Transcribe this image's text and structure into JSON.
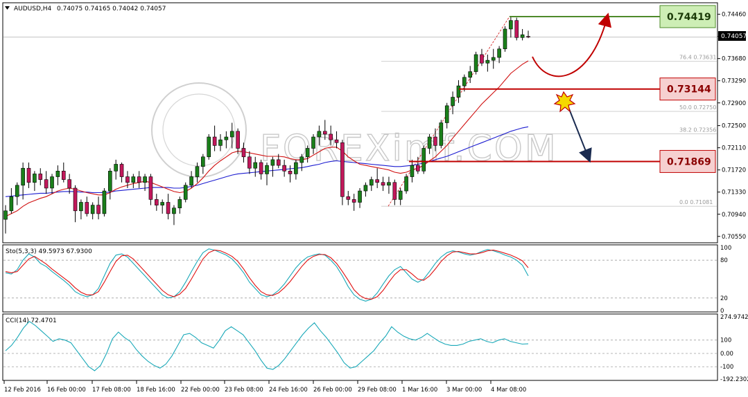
{
  "chart_data": [
    {
      "type": "candlestick",
      "header": {
        "symbol_tf": "AUDUSD,H4",
        "ohlc": "0.74075 0.74165 0.74042 0.74057"
      },
      "y_ticks": [
        "0.74460",
        "0.74070",
        "0.73680",
        "0.73290",
        "0.72900",
        "0.72500",
        "0.72110",
        "0.71720",
        "0.71330",
        "0.70940",
        "0.70550"
      ],
      "y_tick_values": [
        0.7446,
        0.7407,
        0.7368,
        0.7329,
        0.729,
        0.725,
        0.7211,
        0.7172,
        0.7133,
        0.7094,
        0.7055
      ],
      "current_price": "0.74057",
      "ylim": [
        0.7045,
        0.7465
      ],
      "x_ticks": [
        "12 Feb 2016",
        "16 Feb 00:00",
        "17 Feb 08:00",
        "18 Feb 16:00",
        "22 Feb 00:00",
        "23 Feb 08:00",
        "24 Feb 16:00",
        "26 Feb 00:00",
        "29 Feb 08:00",
        "1 Mar 16:00",
        "3 Mar 00:00",
        "4 Mar 08:00"
      ],
      "fib_levels": [
        {
          "label": "76.4",
          "value": "0.73631",
          "price": 0.73631
        },
        {
          "label": "50.0",
          "value": "0.72750",
          "price": 0.7275
        },
        {
          "label": "38.2",
          "value": "0.72356",
          "price": 0.72356
        },
        {
          "label": "0.0",
          "value": "0.71081",
          "price": 0.71081
        }
      ],
      "levels": [
        {
          "label": "0.74419",
          "price": 0.74419,
          "color": "#4e8a2a",
          "fill": "#cdeeb5"
        },
        {
          "label": "0.73144",
          "price": 0.73144,
          "color": "#c00000",
          "fill": "#f6d0d0"
        },
        {
          "label": "0.71869",
          "price": 0.71869,
          "color": "#c00000",
          "fill": "#f6d0d0"
        }
      ],
      "candles": [
        [
          0.7085,
          0.711,
          0.706,
          0.71
        ],
        [
          0.71,
          0.714,
          0.7095,
          0.7125
        ],
        [
          0.7125,
          0.715,
          0.711,
          0.7145
        ],
        [
          0.7145,
          0.7185,
          0.712,
          0.7175
        ],
        [
          0.7175,
          0.7185,
          0.714,
          0.715
        ],
        [
          0.715,
          0.717,
          0.7135,
          0.7165
        ],
        [
          0.7165,
          0.7175,
          0.7145,
          0.7155
        ],
        [
          0.7155,
          0.717,
          0.713,
          0.714
        ],
        [
          0.714,
          0.7165,
          0.713,
          0.716
        ],
        [
          0.716,
          0.718,
          0.7145,
          0.717
        ],
        [
          0.717,
          0.7185,
          0.715,
          0.7155
        ],
        [
          0.7155,
          0.7165,
          0.713,
          0.714
        ],
        [
          0.714,
          0.7145,
          0.708,
          0.71
        ],
        [
          0.71,
          0.712,
          0.7085,
          0.7115
        ],
        [
          0.7115,
          0.7125,
          0.709,
          0.7095
        ],
        [
          0.7095,
          0.7115,
          0.7085,
          0.711
        ],
        [
          0.711,
          0.7125,
          0.7085,
          0.7095
        ],
        [
          0.7095,
          0.714,
          0.709,
          0.7135
        ],
        [
          0.7135,
          0.7175,
          0.712,
          0.717
        ],
        [
          0.717,
          0.719,
          0.7155,
          0.7182
        ],
        [
          0.7182,
          0.7185,
          0.715,
          0.716
        ],
        [
          0.716,
          0.717,
          0.714,
          0.715
        ],
        [
          0.715,
          0.7165,
          0.714,
          0.716
        ],
        [
          0.716,
          0.717,
          0.714,
          0.715
        ],
        [
          0.715,
          0.7165,
          0.7135,
          0.716
        ],
        [
          0.716,
          0.7165,
          0.711,
          0.712
        ],
        [
          0.712,
          0.713,
          0.71,
          0.711
        ],
        [
          0.711,
          0.712,
          0.7095,
          0.7115
        ],
        [
          0.7115,
          0.713,
          0.7085,
          0.7095
        ],
        [
          0.7095,
          0.711,
          0.7075,
          0.7105
        ],
        [
          0.7105,
          0.7125,
          0.7095,
          0.712
        ],
        [
          0.712,
          0.715,
          0.7115,
          0.7145
        ],
        [
          0.7145,
          0.717,
          0.714,
          0.716
        ],
        [
          0.716,
          0.7185,
          0.715,
          0.7178
        ],
        [
          0.7178,
          0.72,
          0.7165,
          0.7195
        ],
        [
          0.7195,
          0.7235,
          0.719,
          0.723
        ],
        [
          0.723,
          0.725,
          0.7205,
          0.7215
        ],
        [
          0.7215,
          0.7235,
          0.7205,
          0.7225
        ],
        [
          0.7225,
          0.724,
          0.721,
          0.723
        ],
        [
          0.723,
          0.7255,
          0.721,
          0.724
        ],
        [
          0.724,
          0.7245,
          0.72,
          0.721
        ],
        [
          0.721,
          0.722,
          0.7185,
          0.7195
        ],
        [
          0.7195,
          0.7205,
          0.7165,
          0.7175
        ],
        [
          0.7175,
          0.7195,
          0.716,
          0.7185
        ],
        [
          0.7185,
          0.719,
          0.7155,
          0.7165
        ],
        [
          0.7165,
          0.7185,
          0.7145,
          0.718
        ],
        [
          0.718,
          0.7195,
          0.716,
          0.719
        ],
        [
          0.719,
          0.72,
          0.7175,
          0.718
        ],
        [
          0.718,
          0.719,
          0.716,
          0.717
        ],
        [
          0.717,
          0.718,
          0.715,
          0.7165
        ],
        [
          0.7165,
          0.719,
          0.7155,
          0.7185
        ],
        [
          0.7185,
          0.72,
          0.717,
          0.7195
        ],
        [
          0.7195,
          0.7215,
          0.7185,
          0.721
        ],
        [
          0.721,
          0.7235,
          0.72,
          0.723
        ],
        [
          0.723,
          0.725,
          0.7215,
          0.724
        ],
        [
          0.724,
          0.726,
          0.7225,
          0.7235
        ],
        [
          0.7235,
          0.725,
          0.7215,
          0.7225
        ],
        [
          0.7225,
          0.724,
          0.721,
          0.722
        ],
        [
          0.722,
          0.7225,
          0.711,
          0.7125
        ],
        [
          0.7125,
          0.7135,
          0.711,
          0.712
        ],
        [
          0.712,
          0.713,
          0.71,
          0.7115
        ],
        [
          0.7115,
          0.714,
          0.7105,
          0.7135
        ],
        [
          0.7135,
          0.715,
          0.7125,
          0.7145
        ],
        [
          0.7145,
          0.716,
          0.7135,
          0.7155
        ],
        [
          0.7155,
          0.7175,
          0.714,
          0.715
        ],
        [
          0.715,
          0.716,
          0.7135,
          0.7145
        ],
        [
          0.7145,
          0.716,
          0.713,
          0.715
        ],
        [
          0.715,
          0.7155,
          0.711,
          0.712
        ],
        [
          0.712,
          0.714,
          0.711,
          0.7135
        ],
        [
          0.7135,
          0.7165,
          0.713,
          0.716
        ],
        [
          0.716,
          0.719,
          0.715,
          0.718
        ],
        [
          0.718,
          0.7195,
          0.7165,
          0.717
        ],
        [
          0.717,
          0.7215,
          0.7165,
          0.721
        ],
        [
          0.721,
          0.7235,
          0.72,
          0.723
        ],
        [
          0.723,
          0.7245,
          0.7205,
          0.7215
        ],
        [
          0.7215,
          0.726,
          0.721,
          0.7255
        ],
        [
          0.7255,
          0.729,
          0.7245,
          0.7285
        ],
        [
          0.7285,
          0.731,
          0.727,
          0.73
        ],
        [
          0.73,
          0.733,
          0.729,
          0.732
        ],
        [
          0.732,
          0.734,
          0.731,
          0.7335
        ],
        [
          0.7335,
          0.7355,
          0.7325,
          0.7345
        ],
        [
          0.7345,
          0.738,
          0.734,
          0.7375
        ],
        [
          0.7375,
          0.7385,
          0.7355,
          0.736
        ],
        [
          0.736,
          0.7375,
          0.7345,
          0.7365
        ],
        [
          0.7365,
          0.7385,
          0.735,
          0.737
        ],
        [
          0.737,
          0.739,
          0.736,
          0.7385
        ],
        [
          0.7385,
          0.7425,
          0.738,
          0.742
        ],
        [
          0.742,
          0.7442,
          0.7405,
          0.7435
        ],
        [
          0.7435,
          0.744,
          0.74,
          0.7405
        ],
        [
          0.7405,
          0.742,
          0.74,
          0.741
        ],
        [
          0.7407,
          0.7417,
          0.7404,
          0.7406
        ]
      ],
      "ma_red": [
        0.709,
        0.7095,
        0.71,
        0.7108,
        0.7114,
        0.7118,
        0.7122,
        0.7125,
        0.713,
        0.7135,
        0.7138,
        0.714,
        0.7138,
        0.7135,
        0.7132,
        0.713,
        0.7128,
        0.7128,
        0.7132,
        0.7138,
        0.7142,
        0.7145,
        0.7148,
        0.715,
        0.7152,
        0.715,
        0.7146,
        0.7142,
        0.7138,
        0.7134,
        0.7132,
        0.7134,
        0.714,
        0.7148,
        0.7158,
        0.717,
        0.718,
        0.7188,
        0.7195,
        0.7202,
        0.7205,
        0.7204,
        0.7202,
        0.72,
        0.7198,
        0.7196,
        0.7196,
        0.7196,
        0.7195,
        0.7192,
        0.719,
        0.719,
        0.7192,
        0.7198,
        0.7204,
        0.721,
        0.7212,
        0.7212,
        0.7205,
        0.7195,
        0.7188,
        0.7182,
        0.718,
        0.7178,
        0.7176,
        0.7174,
        0.7172,
        0.7168,
        0.7166,
        0.7168,
        0.7172,
        0.7175,
        0.718,
        0.7188,
        0.7195,
        0.7205,
        0.7215,
        0.7228,
        0.724,
        0.7252,
        0.7264,
        0.7276,
        0.7288,
        0.7298,
        0.7308,
        0.7318,
        0.733,
        0.7342,
        0.735,
        0.7358,
        0.7364
      ],
      "ma_blue": [
        0.7125,
        0.7126,
        0.7127,
        0.7128,
        0.7129,
        0.713,
        0.7131,
        0.7131,
        0.7132,
        0.7133,
        0.7134,
        0.7134,
        0.7134,
        0.7133,
        0.7133,
        0.7132,
        0.7132,
        0.7132,
        0.7133,
        0.7135,
        0.7136,
        0.7137,
        0.7138,
        0.7139,
        0.714,
        0.7141,
        0.7141,
        0.7141,
        0.7141,
        0.714,
        0.714,
        0.7141,
        0.7143,
        0.7145,
        0.7148,
        0.7151,
        0.7154,
        0.7157,
        0.716,
        0.7163,
        0.7165,
        0.7166,
        0.7167,
        0.7168,
        0.7169,
        0.717,
        0.7171,
        0.7172,
        0.7173,
        0.7174,
        0.7175,
        0.7176,
        0.7178,
        0.718,
        0.7182,
        0.7185,
        0.7187,
        0.7188,
        0.7187,
        0.7186,
        0.7185,
        0.7184,
        0.7183,
        0.7182,
        0.7181,
        0.718,
        0.7179,
        0.7178,
        0.7178,
        0.7179,
        0.718,
        0.7182,
        0.7184,
        0.7187,
        0.719,
        0.7193,
        0.7196,
        0.72,
        0.7204,
        0.7208,
        0.7212,
        0.7216,
        0.722,
        0.7224,
        0.7228,
        0.7232,
        0.7236,
        0.724,
        0.7243,
        0.7246,
        0.7248
      ],
      "watermark": "FOREXimf.COM"
    },
    {
      "type": "line",
      "title": "Sto(5,3,3) 49.5973 67.9300",
      "y_ticks": [
        "100",
        "80",
        "20",
        "0"
      ],
      "y_tick_values": [
        100,
        80,
        20,
        0
      ],
      "ylim": [
        0,
        100
      ],
      "series_k": [
        60,
        58,
        65,
        80,
        90,
        85,
        75,
        70,
        62,
        55,
        48,
        40,
        30,
        25,
        22,
        25,
        35,
        55,
        75,
        88,
        90,
        85,
        75,
        65,
        55,
        45,
        35,
        25,
        20,
        22,
        30,
        45,
        62,
        78,
        92,
        98,
        96,
        92,
        88,
        82,
        72,
        60,
        45,
        35,
        25,
        22,
        25,
        32,
        42,
        55,
        68,
        78,
        85,
        88,
        90,
        88,
        80,
        70,
        55,
        38,
        25,
        18,
        15,
        18,
        28,
        42,
        55,
        65,
        70,
        60,
        50,
        45,
        50,
        62,
        75,
        85,
        92,
        95,
        93,
        90,
        88,
        90,
        94,
        97,
        95,
        92,
        88,
        85,
        80,
        72,
        55
      ],
      "series_d": [
        62,
        60,
        62,
        72,
        82,
        86,
        80,
        74,
        66,
        59,
        52,
        45,
        36,
        29,
        25,
        25,
        30,
        45,
        62,
        78,
        87,
        88,
        82,
        72,
        62,
        52,
        42,
        32,
        25,
        22,
        26,
        35,
        50,
        66,
        82,
        92,
        96,
        95,
        91,
        86,
        78,
        66,
        52,
        40,
        30,
        25,
        24,
        28,
        36,
        46,
        58,
        70,
        80,
        86,
        89,
        89,
        84,
        75,
        62,
        48,
        33,
        24,
        19,
        18,
        22,
        32,
        45,
        57,
        65,
        65,
        58,
        50,
        48,
        55,
        66,
        78,
        87,
        93,
        94,
        92,
        90,
        90,
        92,
        95,
        96,
        94,
        91,
        88,
        84,
        79,
        68
      ]
    },
    {
      "type": "line",
      "title": "CCI(14) 72.4701",
      "y_ticks": [
        "274.9742",
        "100",
        "0.00",
        "-100",
        "-192.2302"
      ],
      "y_tick_values": [
        274.9742,
        100,
        0,
        -100,
        -192.2302
      ],
      "ylim": [
        -192.2302,
        274.9742
      ],
      "series": [
        20,
        60,
        120,
        190,
        240,
        210,
        170,
        130,
        90,
        110,
        100,
        80,
        20,
        -40,
        -100,
        -130,
        -90,
        0,
        110,
        160,
        120,
        90,
        30,
        -20,
        -60,
        -90,
        -110,
        -80,
        -20,
        60,
        140,
        150,
        120,
        80,
        60,
        40,
        100,
        170,
        200,
        170,
        140,
        80,
        20,
        -50,
        -110,
        -120,
        -90,
        -40,
        20,
        80,
        140,
        190,
        230,
        170,
        120,
        60,
        0,
        -70,
        -110,
        -100,
        -60,
        -20,
        20,
        80,
        130,
        200,
        160,
        130,
        110,
        100,
        120,
        150,
        120,
        90,
        70,
        60,
        60,
        70,
        90,
        100,
        110,
        90,
        80,
        100,
        110,
        90,
        80,
        70,
        72
      ]
    }
  ]
}
